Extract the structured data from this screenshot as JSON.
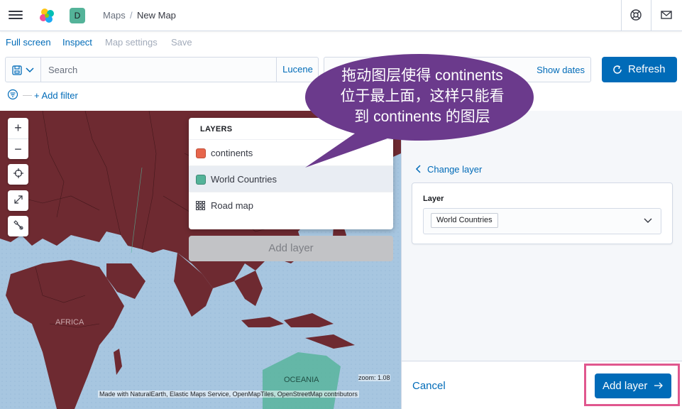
{
  "header": {
    "space_initial": "D",
    "breadcrumbs": [
      "Maps",
      "New Map"
    ],
    "breadcrumb_separator": "/"
  },
  "menu": {
    "full_screen": "Full screen",
    "inspect": "Inspect",
    "map_settings": "Map settings",
    "save": "Save"
  },
  "query": {
    "placeholder": "Search",
    "language": "Lucene"
  },
  "date": {
    "show_dates": "Show dates"
  },
  "refresh_label": "Refresh",
  "filter": {
    "add_filter": "+ Add filter"
  },
  "map": {
    "labels": {
      "africa": "AFRICA",
      "oceania": "OCEANIA"
    },
    "zoom_text": "zoom: 1.08",
    "attribution": "Made with NaturalEarth, Elastic Maps Service, OpenMapTiles, OpenStreetMap contributors",
    "controls": {
      "zoom_in": "+",
      "zoom_out": "−"
    }
  },
  "layers_panel": {
    "title": "LAYERS",
    "items": [
      {
        "label": "continents",
        "color": "#e7664c",
        "icon": "swatch"
      },
      {
        "label": "World Countries",
        "color": "#54b399",
        "icon": "swatch",
        "selected": true
      },
      {
        "label": "Road map",
        "icon": "grid-icon"
      }
    ],
    "add_layer": "Add layer"
  },
  "callout": {
    "line1": "拖动图层使得 continents",
    "line2": "位于最上面，这样只能看",
    "line3": "到 continents 的图层",
    "color": "#6b3a8c"
  },
  "side_panel": {
    "change_layer": "Change layer",
    "layer_label": "Layer",
    "selected_layer": "World Countries",
    "cancel": "Cancel",
    "add_layer": "Add layer"
  },
  "colors": {
    "accent": "#006bb8",
    "land": "#6e2a31",
    "ocean": "#a7c6e0",
    "highlight_border": "#e0578e"
  }
}
